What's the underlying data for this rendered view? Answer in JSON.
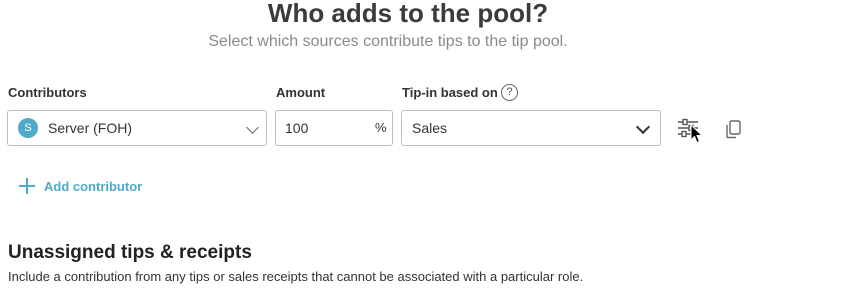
{
  "header": {
    "title": "Who adds to the pool?",
    "subtitle": "Select which sources contribute tips to the tip pool."
  },
  "form": {
    "contributors_label": "Contributors",
    "amount_label": "Amount",
    "tip_in_label": "Tip-in based on",
    "help_glyph": "?",
    "contributor": {
      "avatar_initial": "S",
      "value": "Server (FOH)"
    },
    "amount": {
      "value": "100",
      "unit": "%"
    },
    "tip_in": {
      "value": "Sales"
    }
  },
  "actions": {
    "add_contributor_label": "Add contributor"
  },
  "unassigned": {
    "title": "Unassigned tips & receipts",
    "description": "Include a contribution from any tips or sales receipts that cannot be associated with a particular role."
  },
  "colors": {
    "accent": "#4fa9c9",
    "border": "#bdbdbd",
    "title": "#3b3b3b",
    "subtitle": "#8a8a8a"
  },
  "icons": {
    "help": "question-circle-icon",
    "settings": "sliders-icon",
    "copy": "copy-icon",
    "add": "plus-icon",
    "dropdown": "chevron-down-icon",
    "cursor": "mouse-pointer-icon"
  }
}
